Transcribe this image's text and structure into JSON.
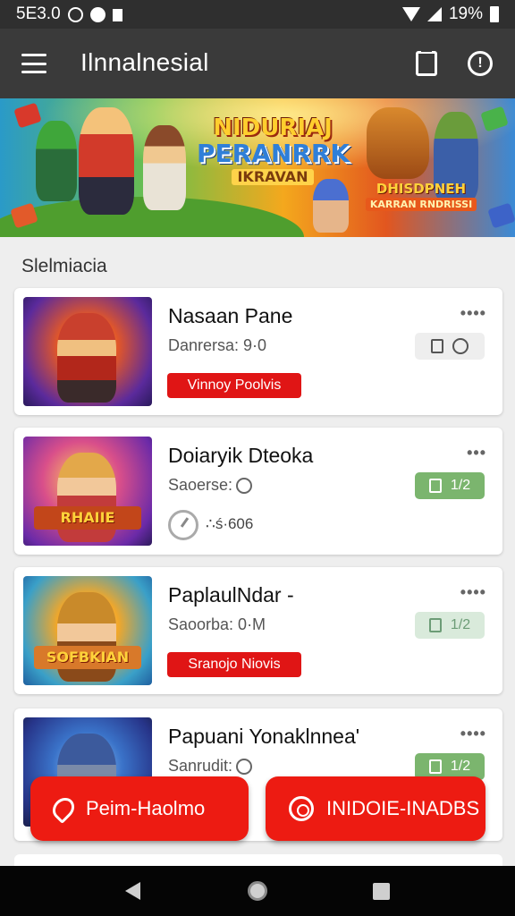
{
  "status_bar": {
    "time": "5E3.0",
    "battery_text": "19%"
  },
  "app_bar": {
    "title": "Ilnnalnesial"
  },
  "banner": {
    "title_line1": "NIDURIAJ",
    "title_line2": "PERANRRK",
    "title_line3": "IKRAVAN",
    "brand_line1": "DHISDPNEH",
    "brand_line2": "KARRAN RNDRISSI"
  },
  "section": {
    "title": "Slelmiacia"
  },
  "cards": [
    {
      "title": "Nasaan Pane",
      "subtitle": "Danrersa: 9·0",
      "button_label": "Vinnoy Poolvis",
      "more": "••••"
    },
    {
      "title": "Doiaryik Dteoka",
      "subtitle": "Saoerse:",
      "timer_text": "∴ś·606",
      "chip_text": "1/2",
      "thumb_badge": "RHAIIE",
      "more": "•••"
    },
    {
      "title": "PaplaulNdar -",
      "subtitle": "Saoorba: 0·M",
      "button_label": "Sranojo Niovis",
      "chip_text": "1/2",
      "thumb_badge": "SOFBKIAN",
      "more": "••••"
    },
    {
      "title": "Papuani Yonaklnnea'",
      "subtitle": "Sanrudit:",
      "chip_text": "1/2",
      "more": "••••"
    }
  ],
  "fabs": {
    "left_label": "Peim-Haolmo",
    "right_label": "INIDOIE-INADBS"
  },
  "colors": {
    "accent_red": "#e01515",
    "app_bar": "#3a3a3a",
    "chip_green": "#7bb56e"
  }
}
